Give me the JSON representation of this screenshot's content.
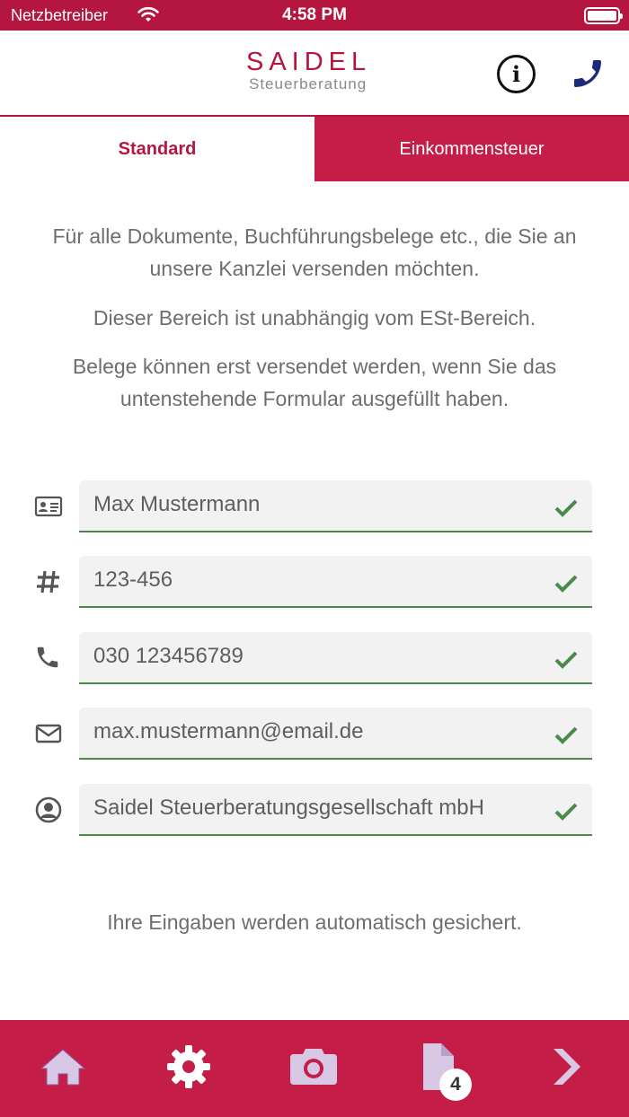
{
  "status_bar": {
    "carrier": "Netzbetreiber",
    "time": "4:58 PM"
  },
  "header": {
    "brand": "SAIDEL",
    "brand_sub": "Steuerberatung",
    "info_symbol": "i",
    "info_icon": "info-circle-icon",
    "phone_icon": "phone-icon"
  },
  "tabs": [
    {
      "label": "Standard",
      "active": true
    },
    {
      "label": "Einkommensteuer",
      "active": false
    }
  ],
  "intro": {
    "line1": "Für alle Dokumente, Buchführungsbelege etc., die Sie an unsere Kanzlei versenden möchten.",
    "line2": "Dieser Bereich ist unabhängig vom ESt-Bereich.",
    "line3": "Belege können erst versendet werden, wenn Sie das untenstehende Formular ausgefüllt haben."
  },
  "form": {
    "name": {
      "value": "Max Mustermann",
      "icon": "id-card-icon"
    },
    "number": {
      "value": "123-456",
      "icon": "hash-icon"
    },
    "phone": {
      "value": "030 123456789",
      "icon": "phone-icon"
    },
    "email": {
      "value": "max.mustermann@email.de",
      "icon": "envelope-icon"
    },
    "company": {
      "value": "Saidel Steuerberatungsgesellschaft mbH",
      "icon": "user-circle-icon"
    }
  },
  "autosave_note": "Ihre Eingaben werden automatisch gesichert.",
  "bottom_nav": {
    "docs_badge": "4",
    "items": [
      "home-icon",
      "gear-icon",
      "camera-icon",
      "document-icon",
      "chevron-right-icon"
    ]
  },
  "colors": {
    "brand": "#b5163f",
    "tab_inactive": "#c41d48",
    "valid": "#4a8a4a",
    "nav_icon": "#d8c8e6"
  }
}
